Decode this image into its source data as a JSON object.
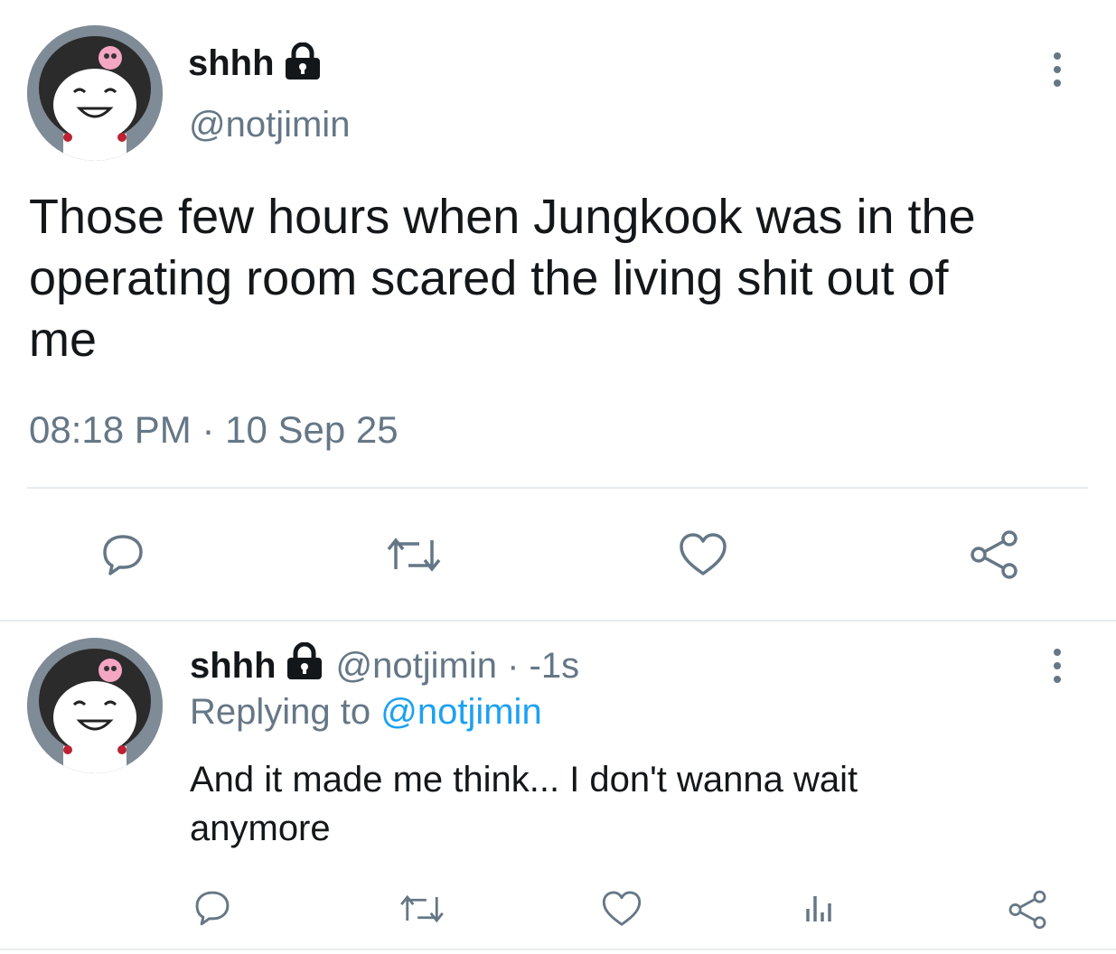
{
  "main_tweet": {
    "display_name": "shhh",
    "handle": "@notjimin",
    "text_line1": "Those few hours when Jungkook was in the",
    "text_line2": "operating room scared the living shit out of",
    "text_line3": "me",
    "timestamp": "08:18 PM · 10 Sep 25",
    "protected_icon": "lock-icon",
    "actions": [
      "reply-icon",
      "retweet-icon",
      "like-icon",
      "share-icon"
    ]
  },
  "reply_tweet": {
    "display_name": "shhh",
    "handle_time": "@notjimin · -1s",
    "replying_prefix": "Replying to",
    "replying_to": "@notjimin",
    "text_line1": "And it made me think... I don't wanna wait",
    "text_line2": "anymore",
    "protected_icon": "lock-icon",
    "actions": [
      "reply-icon",
      "retweet-icon",
      "like-icon",
      "analytics-icon",
      "share-icon"
    ]
  },
  "colors": {
    "text": "#14171a",
    "muted": "#657786",
    "link": "#1da1f2",
    "divider": "#e6ecf0"
  }
}
